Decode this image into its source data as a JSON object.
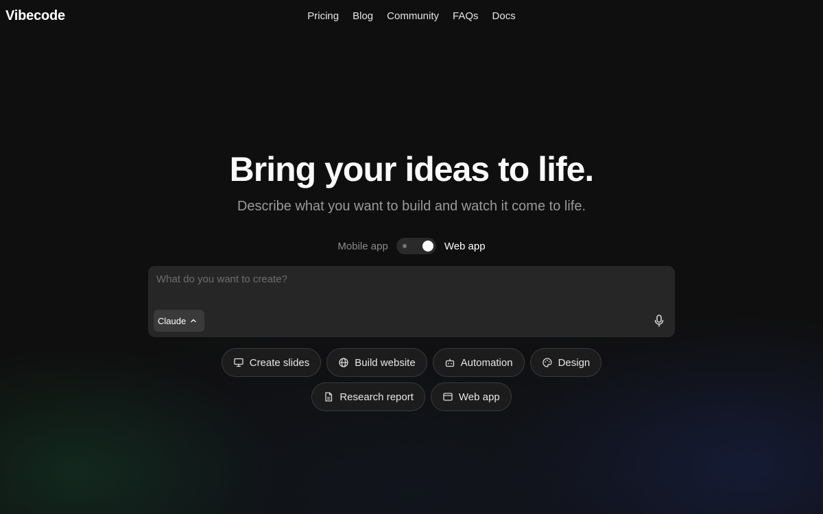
{
  "brand": "Vibecode",
  "nav": {
    "items": [
      "Pricing",
      "Blog",
      "Community",
      "FAQs",
      "Docs"
    ]
  },
  "hero": {
    "title": "Bring your ideas to life.",
    "subtitle": "Describe what you want to build and watch it come to life."
  },
  "mode_toggle": {
    "left_label": "Mobile app",
    "right_label": "Web app",
    "selected": "Web app"
  },
  "prompt": {
    "placeholder": "What do you want to create?",
    "value": "",
    "model": "Claude"
  },
  "chips": {
    "row1": [
      {
        "label": "Create slides",
        "icon": "presentation-icon"
      },
      {
        "label": "Build website",
        "icon": "globe-icon"
      },
      {
        "label": "Automation",
        "icon": "robot-icon"
      },
      {
        "label": "Design",
        "icon": "palette-icon"
      }
    ],
    "row2": [
      {
        "label": "Research report",
        "icon": "document-icon"
      },
      {
        "label": "Web app",
        "icon": "browser-window-icon"
      }
    ]
  },
  "colors": {
    "background": "#0f0f0f",
    "prompt_bg": "#262626",
    "chip_bg": "#1c1c1c",
    "text_muted": "#9a9a9a"
  }
}
